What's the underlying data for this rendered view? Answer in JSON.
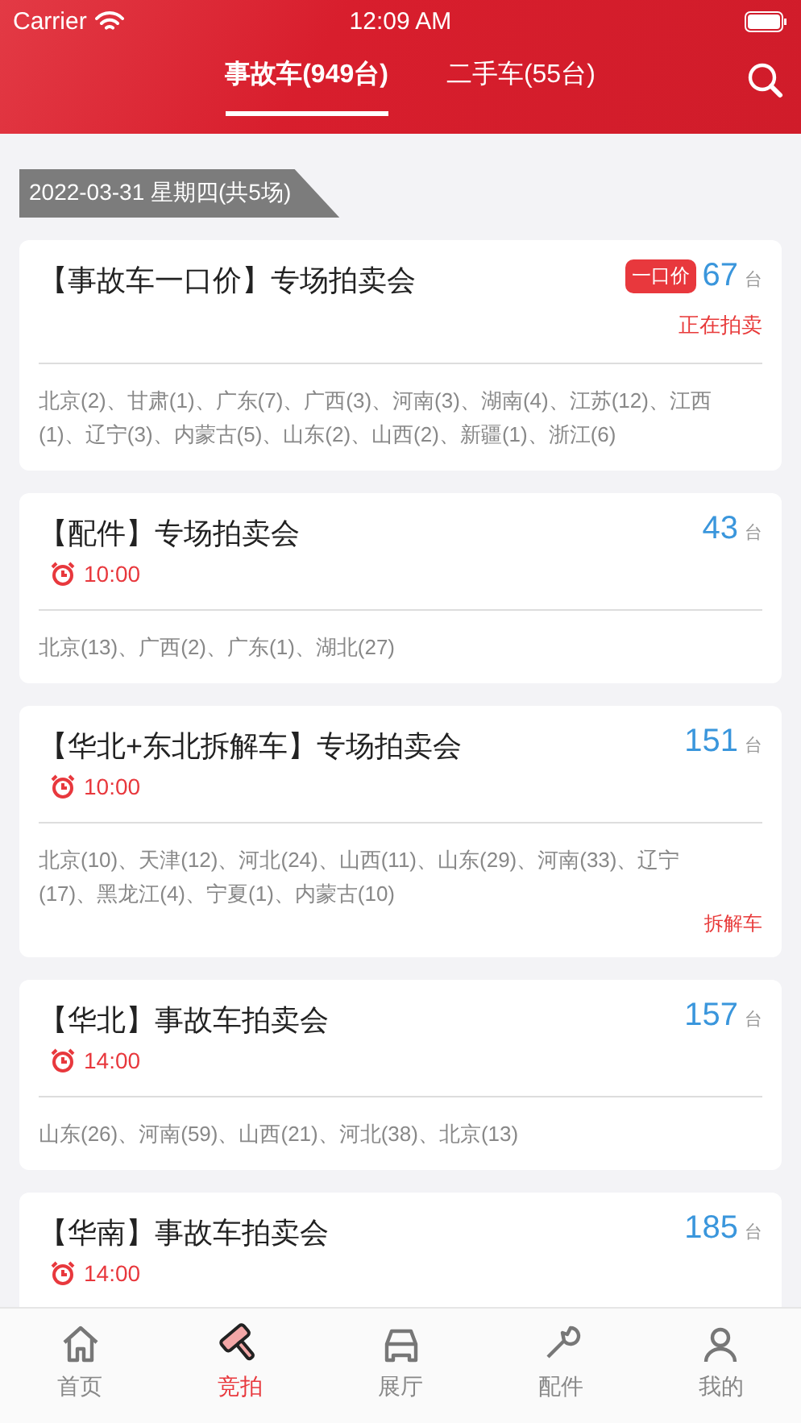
{
  "status_bar": {
    "carrier": "Carrier",
    "time": "12:09 AM"
  },
  "tabs": [
    {
      "label": "事故车(949台)",
      "selected": true
    },
    {
      "label": "二手车(55台)",
      "selected": false
    }
  ],
  "date_label": "2022-03-31 星期四(共5场)",
  "auctions": [
    {
      "title": "【事故车一口价】专场拍卖会",
      "badge": "一口价",
      "count": "67",
      "unit": "台",
      "status": "正在拍卖",
      "regions": "北京(2)、甘肃(1)、广东(7)、广西(3)、河南(3)、湖南(4)、江苏(12)、江西(1)、辽宁(3)、内蒙古(5)、山东(2)、山西(2)、新疆(1)、浙江(6)"
    },
    {
      "title": "【配件】专场拍卖会",
      "count": "43",
      "unit": "台",
      "time": "10:00",
      "regions": "北京(13)、广西(2)、广东(1)、湖北(27)"
    },
    {
      "title": "【华北+东北拆解车】专场拍卖会",
      "count": "151",
      "unit": "台",
      "time": "10:00",
      "regions": "北京(10)、天津(12)、河北(24)、山西(11)、山东(29)、河南(33)、辽宁(17)、黑龙江(4)、宁夏(1)、内蒙古(10)",
      "tag": "拆解车"
    },
    {
      "title": "【华北】事故车拍卖会",
      "count": "157",
      "unit": "台",
      "time": "14:00",
      "regions": "山东(26)、河南(59)、山西(21)、河北(38)、北京(13)"
    },
    {
      "title": "【华南】事故车拍卖会",
      "count": "185",
      "unit": "台",
      "time": "14:00"
    }
  ],
  "tab_bar": [
    {
      "label": "首页",
      "selected": false
    },
    {
      "label": "竞拍",
      "selected": true
    },
    {
      "label": "展厅",
      "selected": false
    },
    {
      "label": "配件",
      "selected": false
    },
    {
      "label": "我的",
      "selected": false
    }
  ]
}
